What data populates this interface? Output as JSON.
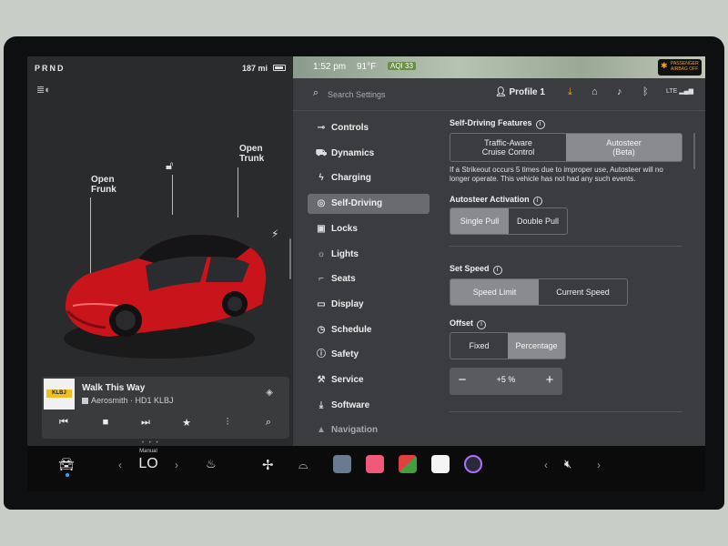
{
  "status": {
    "gear": "PRND",
    "range": "187 mi"
  },
  "map": {
    "time": "1:52 pm",
    "temp": "91°F",
    "aqi": "AQI 33"
  },
  "airbag": {
    "line1": "PASSENGER",
    "line2": "AIRBAG OFF"
  },
  "car": {
    "frunk_label": "Open\nFrunk",
    "trunk_label": "Open\nTrunk",
    "body_color": "#c8141a"
  },
  "media": {
    "album_text": "KLBJ",
    "song": "Walk This Way",
    "artist": "Aerosmith · HD1 KLBJ",
    "controls": [
      "skip-previous-icon",
      "stop-icon",
      "skip-next-icon",
      "favorite-star-icon",
      "equalizer-icon",
      "search-icon"
    ]
  },
  "topbar": {
    "search_placeholder": "Search Settings",
    "profile": "Profile 1",
    "icons": [
      "download-icon",
      "garage-icon",
      "notification-bell-icon",
      "bluetooth-icon",
      "lte-signal-icon"
    ],
    "lte_label": "LTE"
  },
  "sidebar": {
    "items": [
      {
        "label": "Controls",
        "icon": "toggle-icon"
      },
      {
        "label": "Dynamics",
        "icon": "car-icon"
      },
      {
        "label": "Charging",
        "icon": "bolt-icon"
      },
      {
        "label": "Self-Driving",
        "icon": "steering-wheel-icon",
        "active": true
      },
      {
        "label": "Locks",
        "icon": "lock-icon"
      },
      {
        "label": "Lights",
        "icon": "light-icon"
      },
      {
        "label": "Seats",
        "icon": "seat-icon"
      },
      {
        "label": "Display",
        "icon": "display-icon"
      },
      {
        "label": "Schedule",
        "icon": "clock-icon"
      },
      {
        "label": "Safety",
        "icon": "safety-icon"
      },
      {
        "label": "Service",
        "icon": "wrench-icon"
      },
      {
        "label": "Software",
        "icon": "download-icon"
      },
      {
        "label": "Navigation",
        "icon": "navigation-icon"
      }
    ]
  },
  "settings": {
    "features_title": "Self-Driving Features",
    "features_options": [
      "Traffic-Aware\nCruise Control",
      "Autosteer\n(Beta)"
    ],
    "features_selected": 1,
    "strikeout_note": "If a Strikeout occurs 5 times due to improper use, Autosteer will no longer operate. This vehicle has not had any such events.",
    "activation_title": "Autosteer Activation",
    "activation_options": [
      "Single Pull",
      "Double Pull"
    ],
    "activation_selected": 0,
    "set_speed_title": "Set Speed",
    "set_speed_options": [
      "Speed Limit",
      "Current Speed"
    ],
    "set_speed_selected": 0,
    "offset_title": "Offset",
    "offset_options": [
      "Fixed",
      "Percentage"
    ],
    "offset_selected": 1,
    "offset_value": "+5 %",
    "minus": "−",
    "plus": "+",
    "info_glyph": "i"
  },
  "dock": {
    "climate_mode": "Manual",
    "temp": "LO",
    "left_arrow": "‹",
    "right_arrow": "›"
  }
}
